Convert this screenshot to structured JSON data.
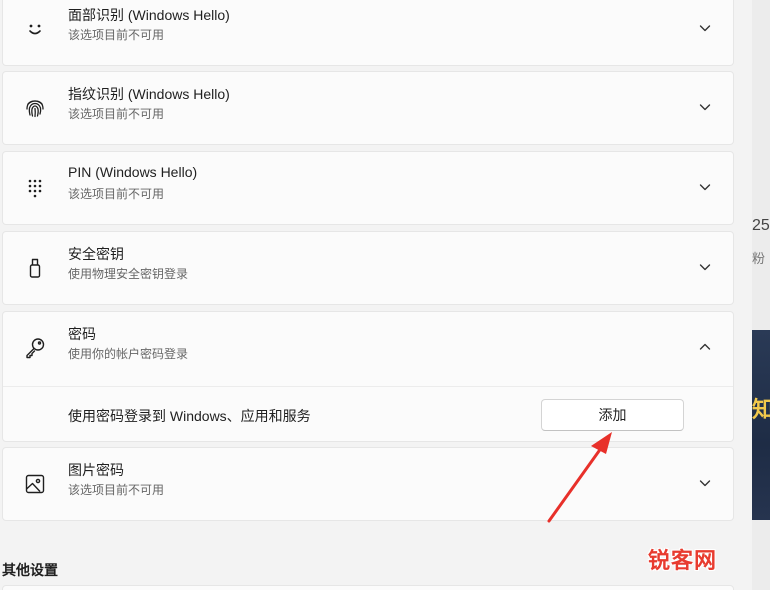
{
  "sign_in_options": {
    "items": [
      {
        "key": "face",
        "icon": "face-smile-icon",
        "title": "面部识别 (Windows Hello)",
        "subtitle": "该选项目前不可用",
        "expanded": false
      },
      {
        "key": "fingerprint",
        "icon": "fingerprint-icon",
        "title": "指纹识别 (Windows Hello)",
        "subtitle": "该选项目前不可用",
        "expanded": false
      },
      {
        "key": "pin",
        "icon": "keypad-dots-icon",
        "title": "PIN (Windows Hello)",
        "subtitle": "该选项目前不可用",
        "expanded": false
      },
      {
        "key": "security_key",
        "icon": "usb-key-icon",
        "title": "安全密钥",
        "subtitle": "使用物理安全密钥登录",
        "expanded": false
      },
      {
        "key": "password",
        "icon": "key-icon",
        "title": "密码",
        "subtitle": "使用你的帐户密码登录",
        "expanded": true,
        "detail_label": "使用密码登录到 Windows、应用和服务",
        "action_label": "添加"
      },
      {
        "key": "picture_password",
        "icon": "picture-icon",
        "title": "图片密码",
        "subtitle": "该选项目前不可用",
        "expanded": false
      }
    ]
  },
  "other_settings": {
    "heading": "其他设置"
  },
  "backdrop": {
    "text_top": "25",
    "text_bottom": "粉",
    "text_band": "知"
  },
  "watermark": {
    "text": "锐客网"
  },
  "colors": {
    "annotation_arrow": "#e8302a",
    "card_background": "#fbfbfb",
    "page_background": "#f3f3f3"
  }
}
